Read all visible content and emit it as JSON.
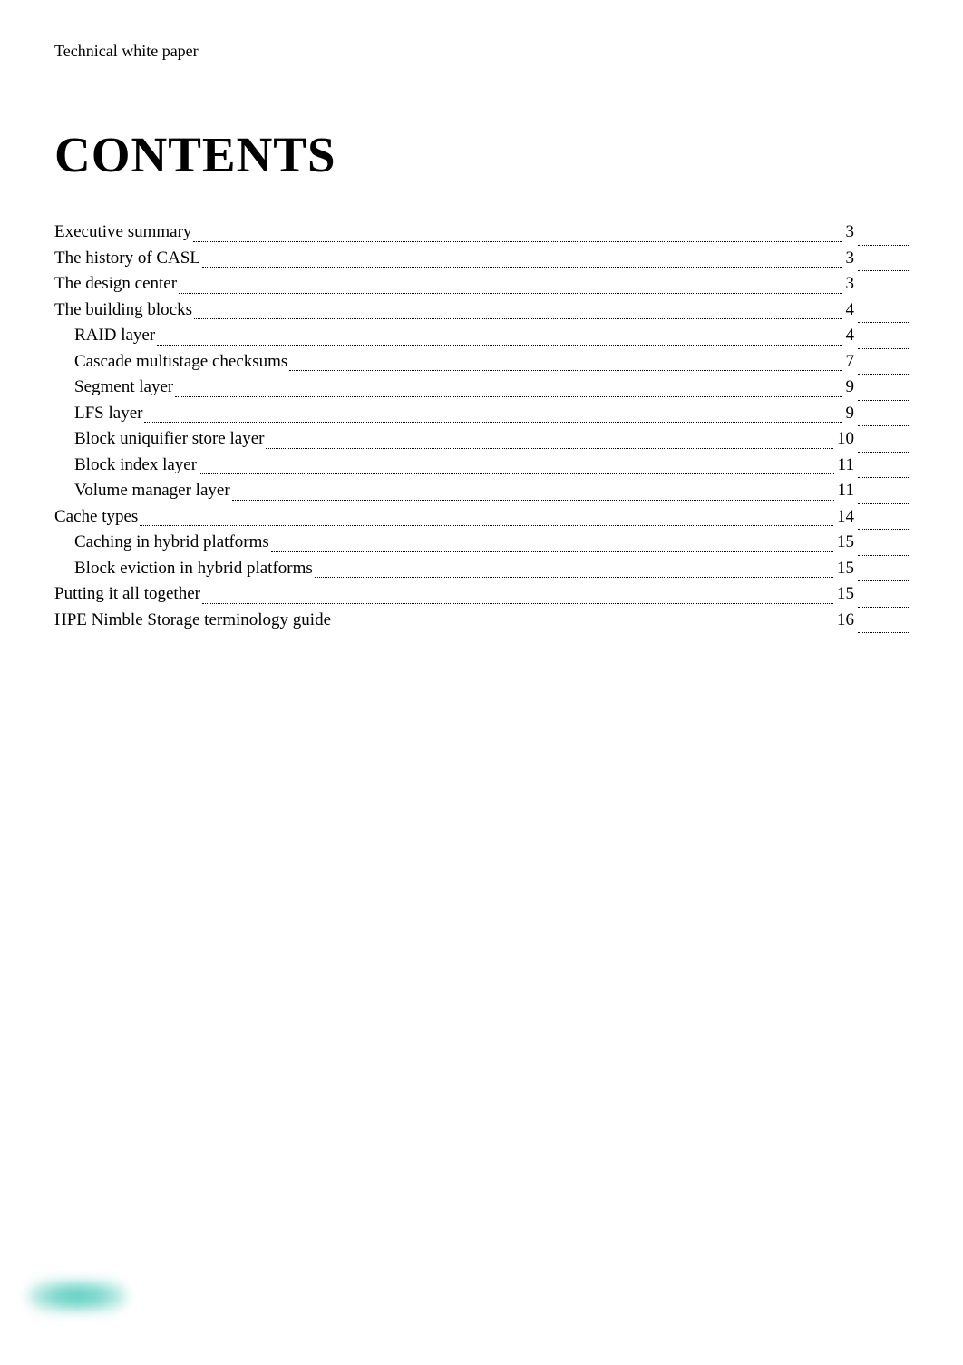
{
  "header": {
    "doc_type": "Technical white paper"
  },
  "title": "CONTENTS",
  "toc": [
    {
      "title": "Executive summary",
      "page": "3",
      "indent": 0
    },
    {
      "title": "The history of CASL",
      "page": "3",
      "indent": 0
    },
    {
      "title": "The design center",
      "page": "3",
      "indent": 0
    },
    {
      "title": "The building blocks",
      "page": "4",
      "indent": 0
    },
    {
      "title": "RAID layer",
      "page": "4",
      "indent": 1
    },
    {
      "title": "Cascade multistage checksums",
      "page": "7",
      "indent": 1
    },
    {
      "title": "Segment layer",
      "page": "9",
      "indent": 1
    },
    {
      "title": "LFS layer",
      "page": "9",
      "indent": 1
    },
    {
      "title": "Block uniquifier store layer",
      "page": "10",
      "indent": 1
    },
    {
      "title": "Block index layer",
      "page": "11",
      "indent": 1
    },
    {
      "title": "Volume manager layer",
      "page": "11",
      "indent": 1
    },
    {
      "title": "Cache types",
      "page": "14",
      "indent": 0
    },
    {
      "title": "Caching in hybrid platforms",
      "page": "15",
      "indent": 1
    },
    {
      "title": "Block eviction in hybrid platforms",
      "page": "15",
      "indent": 1
    },
    {
      "title": "Putting it all together",
      "page": "15",
      "indent": 0
    },
    {
      "title": "HPE Nimble Storage terminology guide",
      "page": "16",
      "indent": 0
    }
  ]
}
